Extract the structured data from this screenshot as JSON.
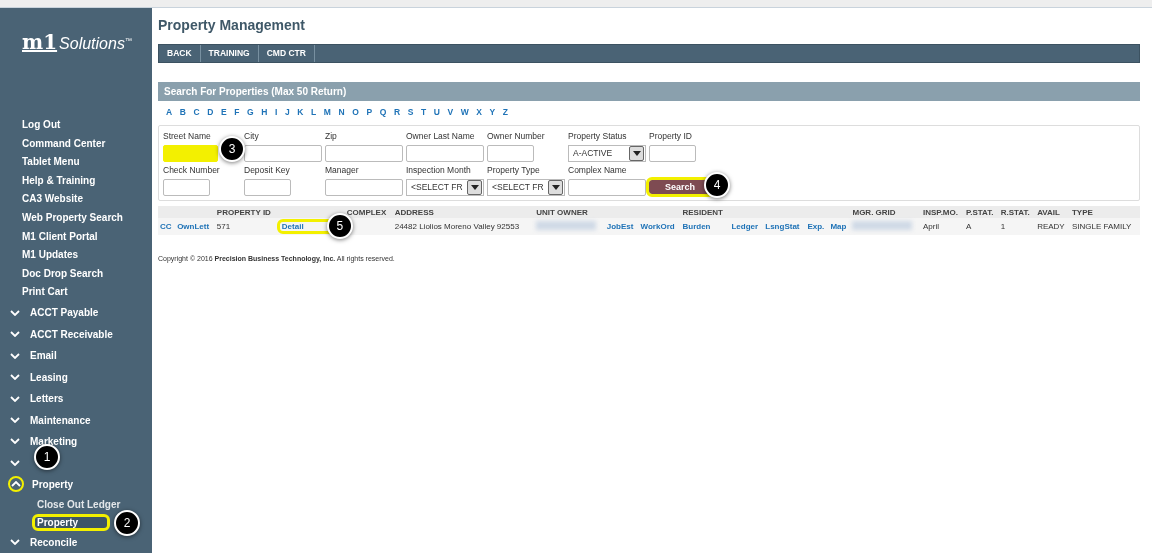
{
  "logo": {
    "mark": "m1",
    "name": "Solutions",
    "tm": "™"
  },
  "sidebar": {
    "links": [
      "Log Out",
      "Command Center",
      "Tablet Menu",
      "Help & Training",
      "CA3 Website",
      "Web Property Search",
      "M1 Client Portal",
      "M1 Updates",
      "Doc Drop Search",
      "Print Cart"
    ],
    "groups": [
      {
        "label": "ACCT Payable",
        "expanded": false
      },
      {
        "label": "ACCT Receivable",
        "expanded": false
      },
      {
        "label": "Email",
        "expanded": false
      },
      {
        "label": "Leasing",
        "expanded": false
      },
      {
        "label": "Letters",
        "expanded": false
      },
      {
        "label": "Maintenance",
        "expanded": false
      },
      {
        "label": "Marketing",
        "expanded": false
      },
      {
        "expanded": false,
        "callout": "1"
      },
      {
        "label": "Property",
        "expanded": true,
        "highlighted": true,
        "children": [
          {
            "label": "Close Out Ledger",
            "selected": false
          },
          {
            "label": "Property",
            "selected": true,
            "highlighted": true,
            "callout": "2"
          }
        ]
      },
      {
        "label": "Reconcile",
        "expanded": false
      }
    ]
  },
  "page": {
    "title": "Property Management",
    "nav": [
      "BACK",
      "TRAINING",
      "CMD CTR"
    ]
  },
  "search": {
    "title": "Search For Properties (Max 50 Return)",
    "letters": [
      "A",
      "B",
      "C",
      "D",
      "E",
      "F",
      "G",
      "H",
      "I",
      "J",
      "K",
      "L",
      "M",
      "N",
      "O",
      "P",
      "Q",
      "R",
      "S",
      "T",
      "U",
      "V",
      "W",
      "X",
      "Y",
      "Z"
    ],
    "rows": [
      [
        {
          "kind": "text",
          "label": "Street Name",
          "narrow": false,
          "highlighted": true,
          "callout": "3"
        },
        {
          "kind": "text",
          "label": "City",
          "narrow": false
        },
        {
          "kind": "text",
          "label": "Zip",
          "narrow": false
        },
        {
          "kind": "text",
          "label": "Owner Last Name",
          "narrow": false
        },
        {
          "kind": "text",
          "label": "Owner Number",
          "narrow": true
        },
        {
          "kind": "select",
          "label": "Property Status",
          "value": "A-ACTIVE"
        },
        {
          "kind": "text",
          "label": "Property ID",
          "narrow": true
        }
      ],
      [
        {
          "kind": "text",
          "label": "Check Number",
          "narrow": true
        },
        {
          "kind": "text",
          "label": "Deposit Key",
          "narrow": true
        },
        {
          "kind": "text",
          "label": "Manager",
          "narrow": false
        },
        {
          "kind": "select",
          "label": "Inspection Month",
          "value": "<SELECT FR"
        },
        {
          "kind": "select",
          "label": "Property Type",
          "value": "<SELECT FR"
        },
        {
          "kind": "text",
          "label": "Complex Name",
          "narrow": false
        },
        {
          "kind": "button",
          "label": "Search",
          "highlighted": true,
          "callout": "4"
        }
      ]
    ]
  },
  "results": {
    "columns": [
      {
        "kind": "link",
        "text": "CC"
      },
      {
        "kind": "link",
        "text": "OwnLett"
      },
      {
        "kind": "text",
        "text": "571",
        "header": "PROPERTY ID"
      },
      {
        "kind": "link",
        "text": "Detail",
        "highlighted": true,
        "callout": "5"
      },
      {
        "kind": "empty",
        "header": "COMPLEX"
      },
      {
        "kind": "text",
        "text": "24482 Liolios Moreno Valley 92553",
        "header": "ADDRESS"
      },
      {
        "kind": "blur",
        "header": "UNIT OWNER"
      },
      {
        "kind": "link",
        "text": "JobEst"
      },
      {
        "kind": "link",
        "text": "WorkOrd"
      },
      {
        "kind": "link",
        "text": "Burden",
        "header": "RESIDENT"
      },
      {
        "kind": "link",
        "text": "Ledger"
      },
      {
        "kind": "link",
        "text": "LsngStat"
      },
      {
        "kind": "link",
        "text": "Exp."
      },
      {
        "kind": "link",
        "text": "Map"
      },
      {
        "kind": "blur",
        "header": "MGR. GRID"
      },
      {
        "kind": "text",
        "text": "April",
        "header": "INSP.MO."
      },
      {
        "kind": "text",
        "text": "A",
        "header": "P.STAT."
      },
      {
        "kind": "text",
        "text": "1",
        "header": "R.STAT."
      },
      {
        "kind": "text",
        "text": "READY",
        "header": "AVAIL"
      },
      {
        "kind": "text",
        "text": "SINGLE FAMILY",
        "header": "TYPE"
      }
    ]
  },
  "copyright": "Copyright © 2016 **Precision Business Technology, Inc.**  All rights reserved."
}
